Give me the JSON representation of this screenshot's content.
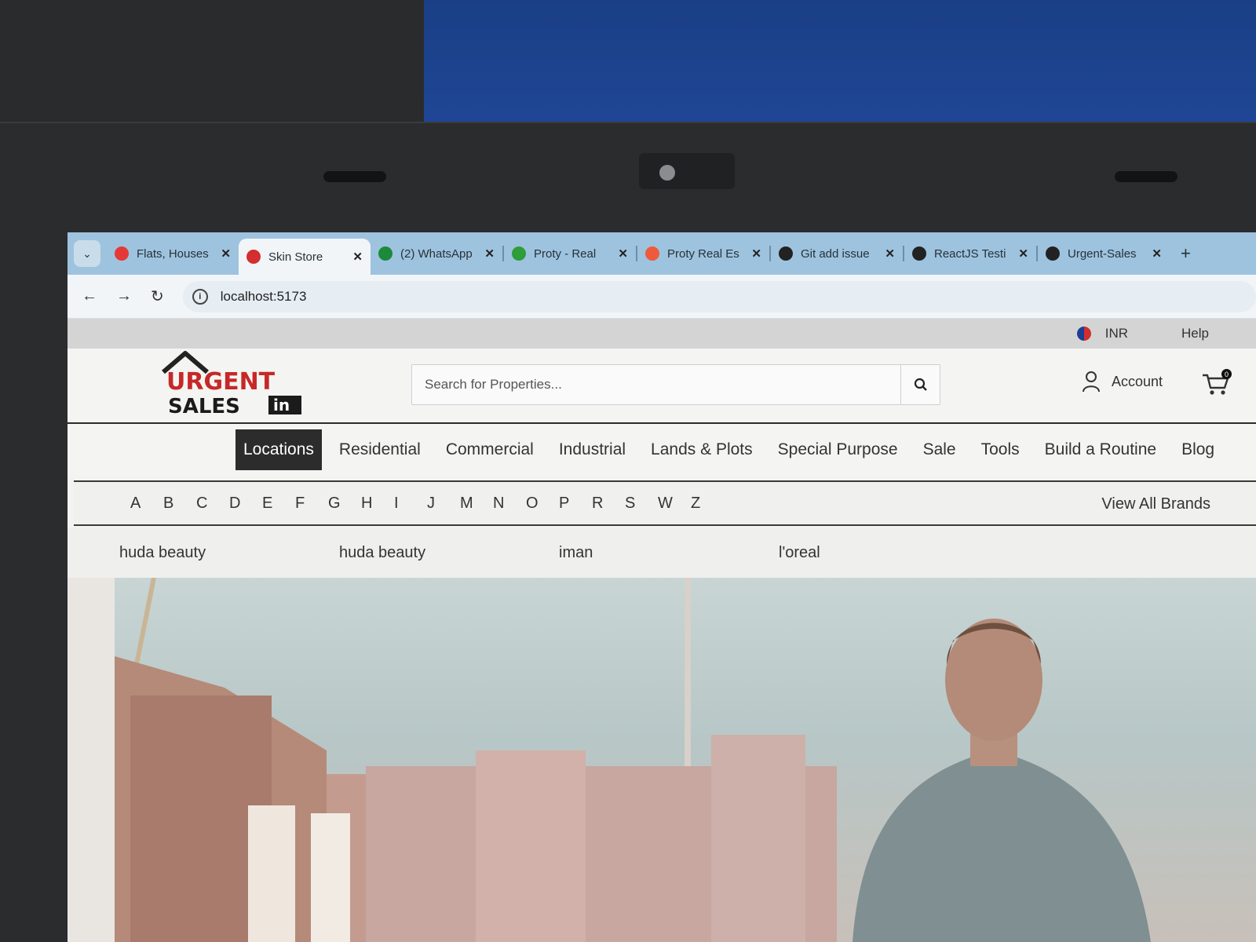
{
  "browser": {
    "tabs": [
      {
        "title": "Flats, Houses",
        "icon_color": "#e53935",
        "active": false
      },
      {
        "title": "Skin Store",
        "icon_color": "#d32f2f",
        "active": true
      },
      {
        "title": "(2) WhatsApp",
        "icon_color": "#1c8a3a",
        "active": false
      },
      {
        "title": "Proty - Real",
        "icon_color": "#2e9d3a",
        "active": false
      },
      {
        "title": "Proty Real Es",
        "icon_color": "#ef5a3a",
        "active": false
      },
      {
        "title": "Git add issue",
        "icon_color": "#222222",
        "active": false
      },
      {
        "title": "ReactJS Testi",
        "icon_color": "#222222",
        "active": false
      },
      {
        "title": "Urgent-Sales",
        "icon_color": "#222222",
        "active": false
      }
    ],
    "url": "localhost:5173"
  },
  "topbar": {
    "currency": "INR",
    "help": "Help"
  },
  "header": {
    "logo_line1": "URGENT",
    "logo_line2": "SALES",
    "logo_suffix": "in",
    "search_placeholder": "Search for Properties...",
    "account_label": "Account",
    "cart_count": "0"
  },
  "nav": {
    "items": [
      "Locations",
      "Residential",
      "Commercial",
      "Industrial",
      "Lands & Plots",
      "Special Purpose",
      "Sale",
      "Tools",
      "Build a Routine",
      "Blog"
    ],
    "active_index": 0
  },
  "alphabet": {
    "letters": [
      "A",
      "B",
      "C",
      "D",
      "E",
      "F",
      "G",
      "H",
      "I",
      "J",
      "M",
      "N",
      "O",
      "P",
      "R",
      "S",
      "W",
      "Z"
    ],
    "view_all": "View All Brands"
  },
  "brands": [
    "huda beauty",
    "huda beauty",
    "iman",
    "l'oreal"
  ],
  "colors": {
    "brand_red": "#c62828",
    "nav_active_bg": "#2c2c2c",
    "tabstrip": "#9ec3df"
  }
}
